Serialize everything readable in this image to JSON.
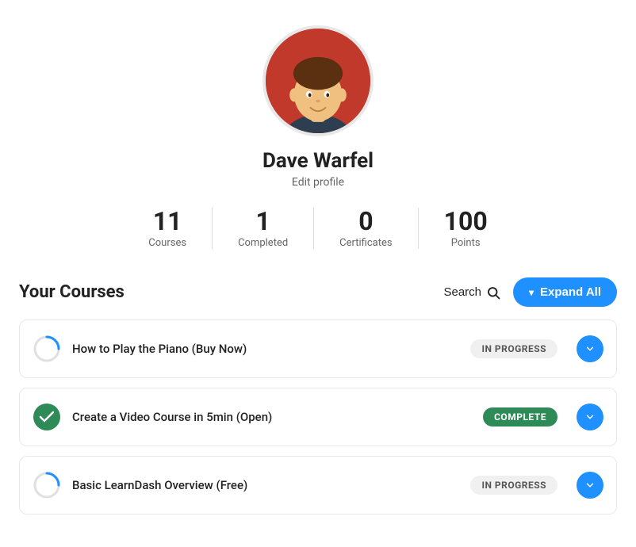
{
  "profile": {
    "name": "Dave Warfel",
    "edit_label": "Edit profile"
  },
  "stats": [
    {
      "value": "11",
      "label": "Courses"
    },
    {
      "value": "1",
      "label": "Completed"
    },
    {
      "value": "0",
      "label": "Certificates"
    },
    {
      "value": "100",
      "label": "Points"
    }
  ],
  "courses_section": {
    "title": "Your Courses",
    "search_label": "Search",
    "expand_label": "Expand All"
  },
  "courses": [
    {
      "name": "How to Play the Piano (Buy Now)",
      "status": "IN PROGRESS",
      "status_type": "in-progress"
    },
    {
      "name": "Create a Video Course in 5min (Open)",
      "status": "COMPLETE",
      "status_type": "complete"
    },
    {
      "name": "Basic LearnDash Overview (Free)",
      "status": "IN PROGRESS",
      "status_type": "in-progress"
    }
  ],
  "colors": {
    "accent_blue": "#1e90ff",
    "complete_green": "#2e8b57"
  }
}
